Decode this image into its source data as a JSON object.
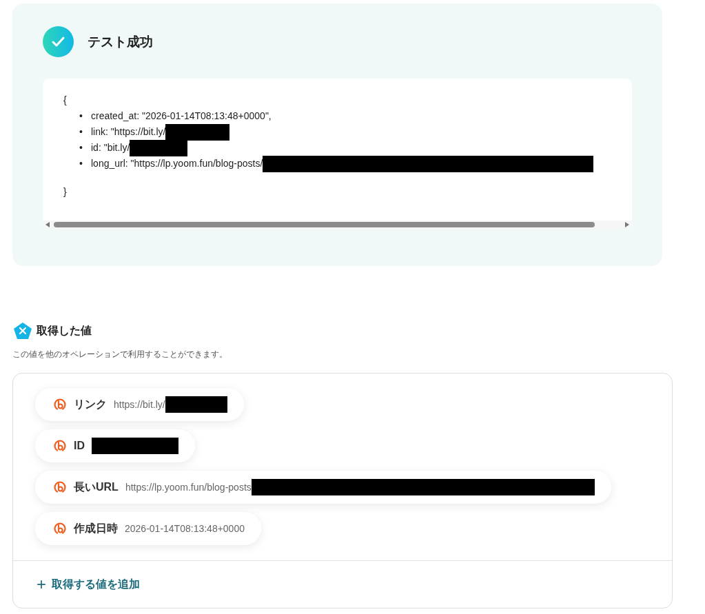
{
  "test_result": {
    "title": "テスト成功",
    "open_brace": "{",
    "close_brace": "}",
    "lines": [
      {
        "marker": "•",
        "text": "created_at: \"2026-01-14T08:13:48+0000\",",
        "redacted": false
      },
      {
        "marker": "•",
        "text": "link: \"https://bit.ly/",
        "redacted": true
      },
      {
        "marker": "•",
        "text": "id: \"bit.ly/",
        "redacted": true
      },
      {
        "marker": "•",
        "text": "long_url: \"https://lp.yoom.fun/blog-posts/",
        "redacted": true
      }
    ]
  },
  "values_section": {
    "title": "取得した値",
    "description": "この値を他のオペレーションで利用することができます。",
    "items": [
      {
        "label": "リンク",
        "value": "https://bit.ly/",
        "redacted": true
      },
      {
        "label": "ID",
        "value": "",
        "redacted": true
      },
      {
        "label": "長いURL",
        "value": "https://lp.yoom.fun/blog-posts",
        "redacted": true
      },
      {
        "label": "作成日時",
        "value": "2026-01-14T08:13:48+0000",
        "redacted": false
      }
    ],
    "add_button": {
      "icon": "+",
      "label": "取得する値を追加"
    }
  }
}
